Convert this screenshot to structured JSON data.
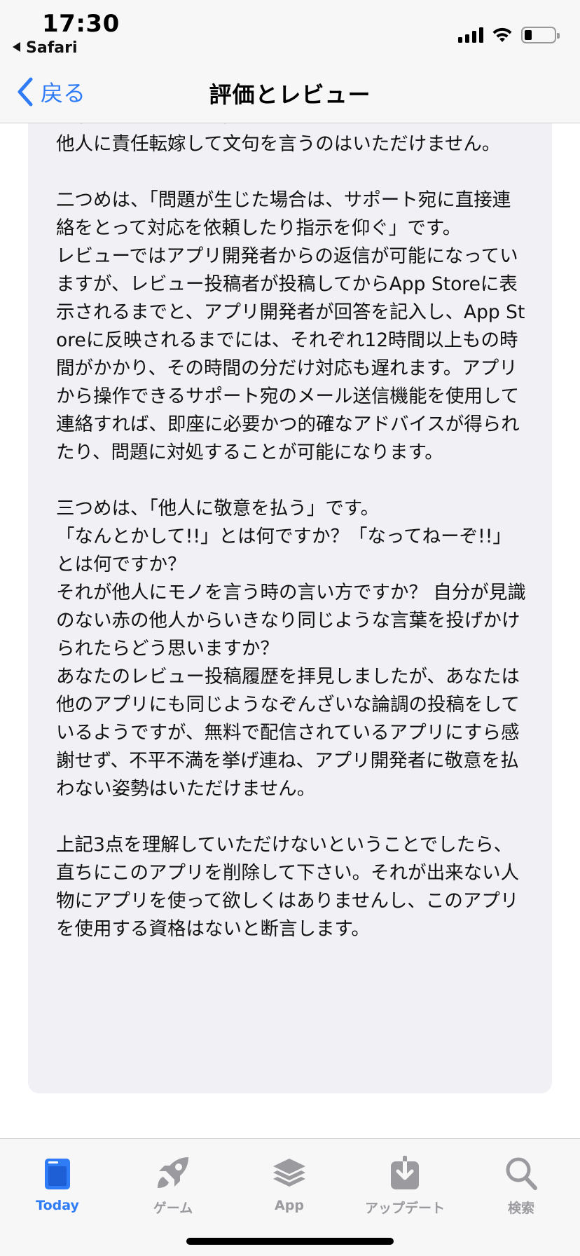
{
  "status_bar": {
    "time": "17:30",
    "back_app": "Safari"
  },
  "nav": {
    "back_label": "戻る",
    "title": "評価とレビュー"
  },
  "review": {
    "text": "表示されているにも関わらず、やるべきことをやらずに他人に責任転嫁して文句を言うのはいただけません。\n\n二つめは、「問題が生じた場合は、サポート宛に直接連絡をとって対応を依頼したり指示を仰ぐ」です。\nレビューではアプリ開発者からの返信が可能になっていますが、レビュー投稿者が投稿してからApp Storeに表示されるまでと、アプリ開発者が回答を記入し、App Storeに反映されるまでには、それぞれ12時間以上もの時間がかかり、その時間の分だけ対応も遅れます。アプリから操作できるサポート宛のメール送信機能を使用して連絡すれば、即座に必要かつ的確なアドバイスが得られたり、問題に対処することが可能になります。\n\n三つめは、「他人に敬意を払う」です。\n「なんとかして!!」とは何ですか？「なってねーぞ!!」とは何ですか？\nそれが他人にモノを言う時の言い方ですか？ 自分が見識のない赤の他人からいきなり同じような言葉を投げかけられたらどう思いますか？\nあなたのレビュー投稿履歴を拝見しましたが、あなたは他のアプリにも同じようなぞんざいな論調の投稿をしているようですが、無料で配信されているアプリにすら感謝せず、不平不満を挙げ連ね、アプリ開発者に敬意を払わない姿勢はいただけません。\n\n上記3点を理解していただけないということでしたら、直ちにこのアプリを削除して下さい。それが出来ない人物にアプリを使って欲しくはありませんし、このアプリを使用する資格はないと断言します。"
  },
  "tabs": [
    {
      "label": "Today",
      "icon": "today-icon",
      "active": true
    },
    {
      "label": "ゲーム",
      "icon": "rocket-icon",
      "active": false
    },
    {
      "label": "App",
      "icon": "layers-icon",
      "active": false
    },
    {
      "label": "アップデート",
      "icon": "download-icon",
      "active": false
    },
    {
      "label": "検索",
      "icon": "search-icon",
      "active": false
    }
  ],
  "colors": {
    "accent": "#2f7cf6",
    "inactive": "#9a9a9f",
    "card_bg": "#f0f0f5",
    "bar_bg": "#f7f7f8"
  }
}
